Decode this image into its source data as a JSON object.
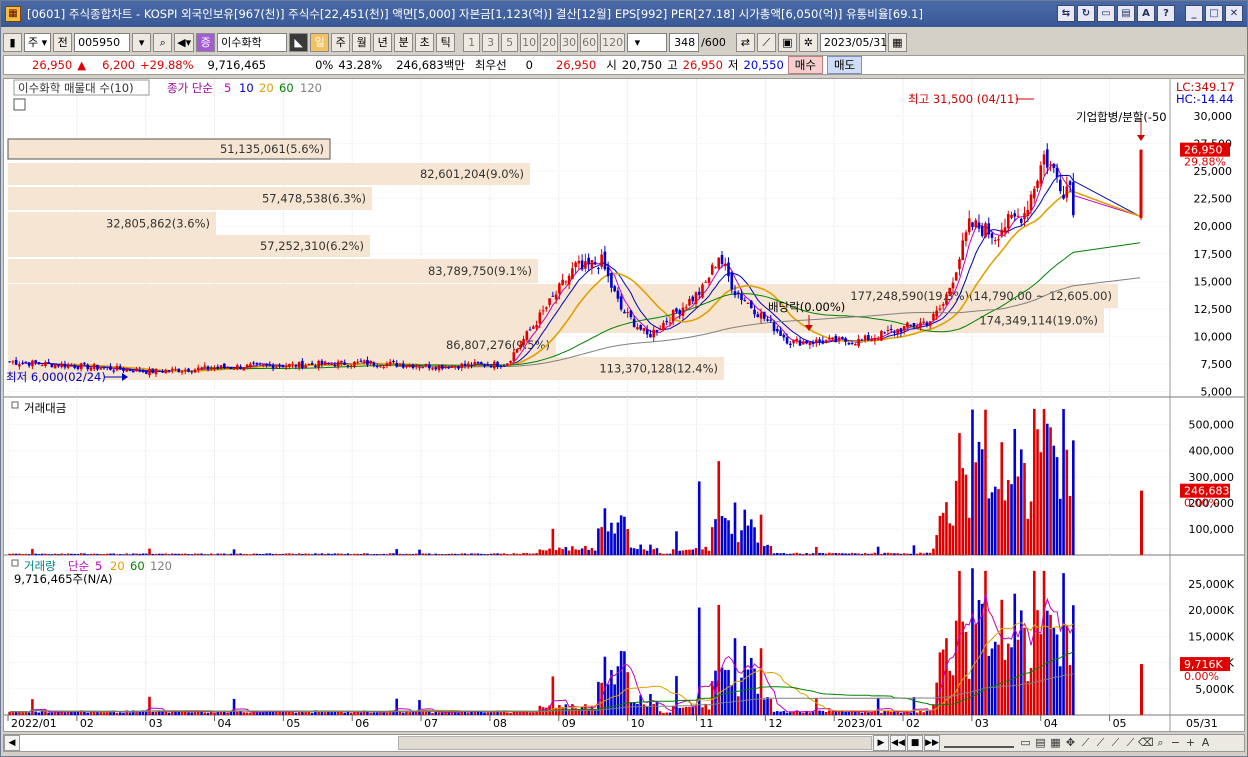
{
  "titlebar": {
    "title": "[0601] 주식종합차트 - KOSPI 외국인보유[967(천)] 주식수[22,451(천)] 액면[5,000] 자본금[1,123(억)] 결산[12월] EPS[992] PER[27.18] 시가총액[6,050(억)] 유통비율[69.1]"
  },
  "toolbar": {
    "type_select": "주",
    "prev_label": "전",
    "code": "005950",
    "stock_name": "이수화학",
    "periods": [
      "일",
      "주",
      "월",
      "년",
      "분",
      "초",
      "틱"
    ],
    "selected_period": "일",
    "intervals": [
      "1",
      "3",
      "5",
      "10",
      "20",
      "30",
      "60",
      "120"
    ],
    "count": "348",
    "count_total": "/600",
    "date": "2023/05/31"
  },
  "quote": {
    "price": "26,950",
    "change": "6,200",
    "change_pct": "+29.88%",
    "volume": "9,716,465",
    "ratio": "0%",
    "ratio_pct": "43.28%",
    "amount": "246,683백만",
    "pref_label": "최우선",
    "pref_value": "0",
    "pref_price": "26,950",
    "open_label": "시",
    "open": "20,750",
    "high_label": "고",
    "high": "26,950",
    "low_label": "저",
    "low": "20,550",
    "buy_label": "매수",
    "sell_label": "매도"
  },
  "price_panel": {
    "legend_volume_profile": "이수화학 매물대 수(10)",
    "legend_ma_prefix": "종가 단순",
    "ma_periods": [
      "5",
      "10",
      "20",
      "60",
      "120"
    ],
    "ma_colors": [
      "#c000c0",
      "#0000c0",
      "#e0a000",
      "#008000",
      "#808080"
    ],
    "lc_label": "LC:349.17",
    "hc_label": "HC:-14.44",
    "high_annotation": "최고 31,500 (04/11)",
    "low_annotation": "최저 6,000(02/24)",
    "merger_annotation": "기업합병/분할(-50",
    "dividend_annotation": "배당락(0.00%)",
    "current_price_tag": "26,950",
    "current_pct_tag": "29.88%",
    "y_ticks": [
      "30,000",
      "27,500",
      "25,000",
      "22,500",
      "20,000",
      "17,500",
      "15,000",
      "12,500",
      "10,000",
      "7,500",
      "5,000"
    ],
    "volume_profile": [
      {
        "label": "51,135,061(5.6%)",
        "pct": 5.6
      },
      {
        "label": "82,601,204(9.0%)",
        "pct": 9.0
      },
      {
        "label": "57,478,538(6.3%)",
        "pct": 6.3
      },
      {
        "label": "32,805,862(3.6%)",
        "pct": 3.6
      },
      {
        "label": "57,252,310(6.2%)",
        "pct": 6.2
      },
      {
        "label": "83,789,750(9.1%)",
        "pct": 9.1
      },
      {
        "label": "177,248,590(19.3%)(14,790.00 ~ 12,605.00)",
        "pct": 19.3
      },
      {
        "label": "174,349,114(19.0%)",
        "pct": 19.0
      },
      {
        "label": "86,807,276(9.5%)",
        "pct": 9.5
      },
      {
        "label": "113,370,128(12.4%)",
        "pct": 12.4
      }
    ]
  },
  "amount_panel": {
    "legend": "거래대금",
    "y_ticks": [
      "500,000",
      "400,000",
      "300,000",
      "200,000",
      "100,000"
    ],
    "current_tag": "246,683",
    "current_pct": "0.00%"
  },
  "volume_panel": {
    "legend_title": "거래량",
    "legend_ma_prefix": "단순",
    "ma_periods": [
      "5",
      "20",
      "60",
      "120"
    ],
    "current_volume_text": "9,716,465주(N/A)",
    "y_ticks": [
      "25,000K",
      "20,000K",
      "15,000K",
      "10,000K",
      "5,000K"
    ],
    "current_tag": "9,716K",
    "current_pct": "0.00%"
  },
  "x_axis": {
    "labels": [
      "2022/01",
      "02",
      "03",
      "04",
      "05",
      "06",
      "07",
      "08",
      "09",
      "10",
      "11",
      "12",
      "2023/01",
      "02",
      "03",
      "04",
      "05"
    ],
    "end_label": "05/31"
  },
  "chart_data": {
    "type": "candlestick",
    "title": "이수화학 (005950) 일봉",
    "x": [
      "2022/01",
      "2022/02",
      "2022/03",
      "2022/04",
      "2022/05",
      "2022/06",
      "2022/07",
      "2022/08",
      "2022/09",
      "2022/10",
      "2022/11",
      "2022/12",
      "2023/01",
      "2023/02",
      "2023/03",
      "2023/04",
      "2023/05"
    ],
    "close_path": [
      7700,
      7300,
      6800,
      7200,
      7400,
      7600,
      7300,
      7500,
      16500,
      10000,
      15500,
      9500,
      9600,
      11500,
      20000,
      24000,
      26950
    ],
    "ylim": [
      4500,
      33000
    ],
    "series": [
      {
        "name": "MA5",
        "color": "#c000c0"
      },
      {
        "name": "MA10",
        "color": "#0000c0"
      },
      {
        "name": "MA20",
        "color": "#e0a000"
      },
      {
        "name": "MA60",
        "color": "#008000"
      },
      {
        "name": "MA120",
        "color": "#808080"
      }
    ],
    "high": {
      "value": 31500,
      "date": "04/11"
    },
    "low": {
      "value": 6000,
      "date": "02/24"
    },
    "last": {
      "open": 20750,
      "high": 26950,
      "low": 20550,
      "close": 26950
    }
  }
}
